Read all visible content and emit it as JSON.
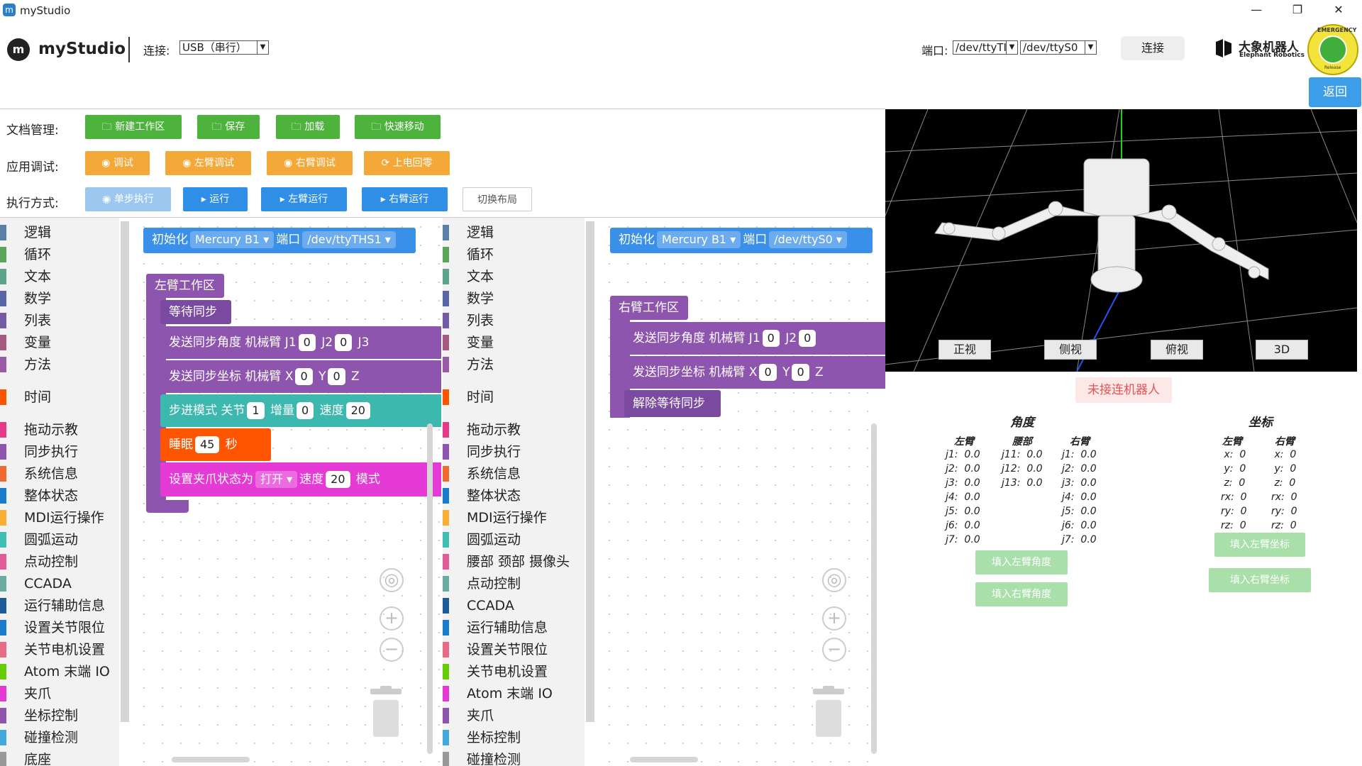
{
  "window": {
    "title": "myStudio",
    "minimize_icon": "minimize-icon",
    "restore_icon": "restore-icon",
    "close_icon": "close-icon"
  },
  "header": {
    "app_name": "myStudio",
    "connect_label": "连接:",
    "connect_value": "USB（串行）",
    "port_label": "端口:",
    "port1": "/dev/ttyTI",
    "port2": "/dev/ttyS0",
    "connect_button": "连接",
    "brand_name": "大象机器人",
    "brand_sub": "Elephant Robotics",
    "emergency_top": "EMERGENCY",
    "emergency_bottom": "Release",
    "back_button": "返回"
  },
  "toolbar": {
    "doc_label": "文档管理:",
    "doc_buttons": [
      "新建工作区",
      "保存",
      "加载",
      "快速移动"
    ],
    "debug_label": "应用调试:",
    "debug_buttons": [
      "调试",
      "左臂调试",
      "右臂调试",
      "上电回零"
    ],
    "exec_label": "执行方式:",
    "exec_buttons": [
      "单步执行",
      "运行",
      "左臂运行",
      "右臂运行",
      "切换布局"
    ]
  },
  "categories_left": [
    "逻辑",
    "循环",
    "文本",
    "数学",
    "列表",
    "变量",
    "方法",
    "时间",
    "拖动示教",
    "同步执行",
    "系统信息",
    "整体状态",
    "MDI运行操作",
    "圆弧运动",
    "点动控制",
    "CCADA",
    "运行辅助信息",
    "设置关节限位",
    "关节电机设置",
    "Atom 末端 IO",
    "夹爪",
    "坐标控制",
    "碰撞检测",
    "底座"
  ],
  "categories_right": [
    "逻辑",
    "循环",
    "文本",
    "数学",
    "列表",
    "变量",
    "方法",
    "时间",
    "拖动示教",
    "同步执行",
    "系统信息",
    "整体状态",
    "MDI运行操作",
    "圆弧运动",
    "腰部 颈部 摄像头",
    "点动控制",
    "CCADA",
    "运行辅助信息",
    "设置关节限位",
    "关节电机设置",
    "Atom 末端 IO",
    "夹爪",
    "坐标控制",
    "碰撞检测"
  ],
  "category_colors": [
    "#5b80a5",
    "#5ba55b",
    "#5ba58c",
    "#5b67a5",
    "#745ba5",
    "#a55b80",
    "#995ba5",
    "#ff5500",
    "#e6398a",
    "#8e55ae",
    "#f06a2f",
    "#1a7ccc",
    "#f7b034",
    "#3fbfb1",
    "#e25d98",
    "#6aaa9f",
    "#1d5b99",
    "#1a7ccc",
    "#e86a86",
    "#66cc00",
    "#e63ad6",
    "#8e55ae",
    "#44aadd",
    "#999999"
  ],
  "left_ws": {
    "init_label": "初始化",
    "robot_value": "Mercury B1",
    "port_label": "端口",
    "port_value": "/dev/ttyTHS1",
    "arm_label": "左臂工作区",
    "wait_sync": "等待同步",
    "send_angle": "发送同步角度 机械臂 J1",
    "j1": "0",
    "j2_label": "J2",
    "j2": "0",
    "j3_label": "J3",
    "send_coord": "发送同步坐标 机械臂 X",
    "x": "0",
    "y_label": "Y",
    "y": "0",
    "z_label": "Z",
    "step_label": "步进模式 关节",
    "step_joint": "1",
    "inc_label": "增量",
    "inc": "0",
    "speed_label": "速度",
    "speed_partial": "20",
    "sleep_label": "睡眠",
    "sleep_value": "45",
    "sec_label": "秒",
    "gripper_label": "设置夹爪状态为",
    "gripper_state": "打开",
    "g_speed_label": "速度",
    "g_speed": "20",
    "mode_label": "模式"
  },
  "right_ws": {
    "init_label": "初始化",
    "robot_value": "Mercury B1",
    "port_label": "端口",
    "port_value": "/dev/ttyS0",
    "arm_label": "右臂工作区",
    "send_angle": "发送同步角度 机械臂 J1",
    "j1": "0",
    "j2_label": "J2",
    "j2": "0",
    "send_coord": "发送同步坐标 机械臂 X",
    "x": "0",
    "y_label": "Y",
    "y": "0",
    "z_label": "Z",
    "release_sync": "解除等待同步"
  },
  "view_buttons": [
    "正视",
    "侧视",
    "俯视",
    "3D"
  ],
  "status": {
    "not_connected": "未接连机器人"
  },
  "angles": {
    "title": "角度",
    "left_h": "左臂",
    "waist_h": "腰部",
    "right_h": "右臂",
    "left": [
      "j1:  0.0",
      "j2:  0.0",
      "j3:  0.0",
      "j4:  0.0",
      "j5:  0.0",
      "j6:  0.0",
      "j7:  0.0"
    ],
    "waist": [
      "j11:  0.0",
      "j12:  0.0",
      "j13:  0.0"
    ],
    "right": [
      "j1:  0.0",
      "j2:  0.0",
      "j3:  0.0",
      "j4:  0.0",
      "j5:  0.0",
      "j6:  0.0",
      "j7:  0.0"
    ],
    "fill_left": "填入左臂角度",
    "fill_right": "填入右臂角度"
  },
  "coords": {
    "title": "坐标",
    "left_h": "左臂",
    "right_h": "右臂",
    "left": [
      " x:  0",
      " y:  0",
      " z:  0",
      "rx:  0",
      "ry:  0",
      "rz:  0"
    ],
    "right": [
      " x:  0",
      " y:  0",
      " z:  0",
      "rx:  0",
      "ry:  0",
      "rz:  0"
    ],
    "fill_left": "填入左臂坐标",
    "fill_right": "填入右臂坐标"
  }
}
